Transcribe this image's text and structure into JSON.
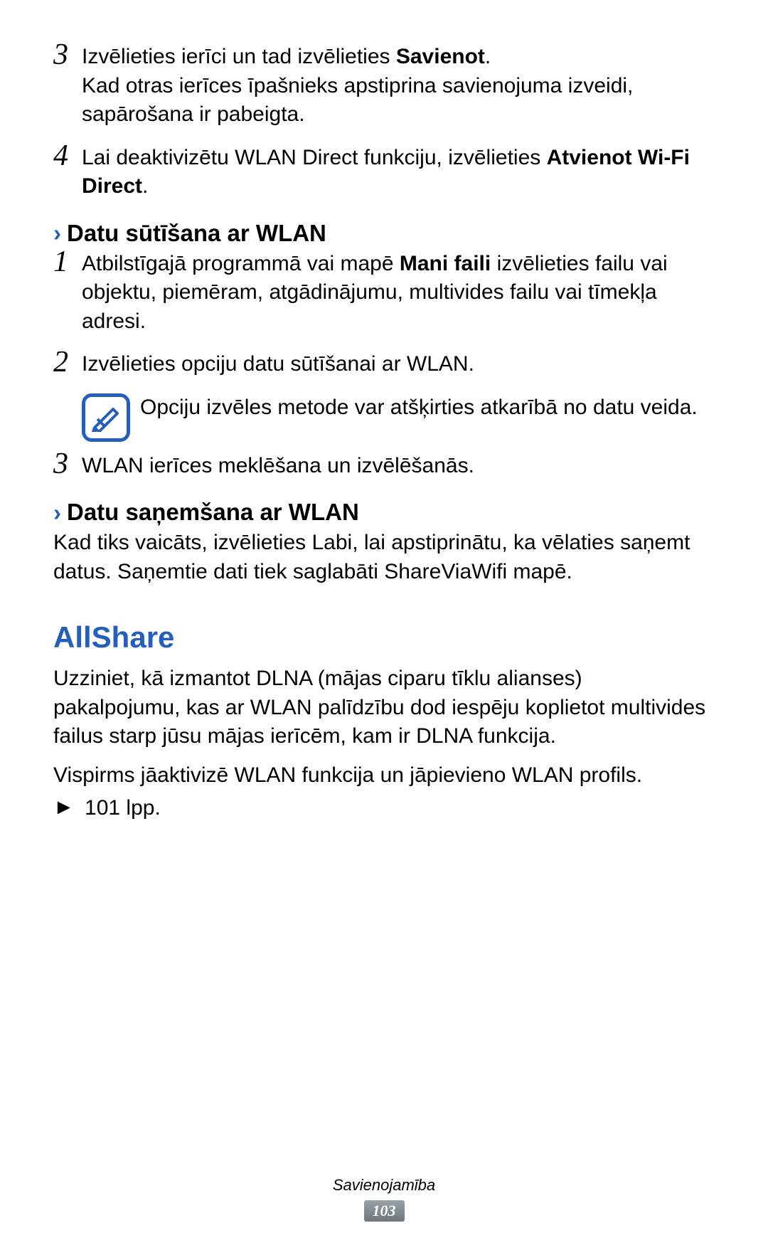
{
  "steps_a": [
    {
      "num": "3",
      "html_parts": [
        {
          "t": "Izvēlieties ierīci un tad izvēlieties ",
          "b": false
        },
        {
          "t": "Savienot",
          "b": true
        },
        {
          "t": ".",
          "b": false
        }
      ],
      "extra": "Kad otras ierīces īpašnieks apstiprina savienojuma izveidi, sapārošana ir pabeigta."
    },
    {
      "num": "4",
      "html_parts": [
        {
          "t": "Lai deaktivizētu WLAN Direct funkciju, izvēlieties ",
          "b": false
        },
        {
          "t": "Atvienot Wi-Fi Direct",
          "b": true
        },
        {
          "t": ".",
          "b": false
        }
      ]
    }
  ],
  "section1": {
    "chevron": "›",
    "title": "Datu sūtīšana ar WLAN",
    "steps": [
      {
        "num": "1",
        "html_parts": [
          {
            "t": "Atbilstīgajā programmā vai mapē ",
            "b": false
          },
          {
            "t": "Mani faili",
            "b": true
          },
          {
            "t": " izvēlieties failu vai objektu, piemēram, atgādinājumu, multivides failu vai tīmekļa adresi.",
            "b": false
          }
        ]
      },
      {
        "num": "2",
        "html_parts": [
          {
            "t": "Izvēlieties opciju datu sūtīšanai ar WLAN.",
            "b": false
          }
        ]
      }
    ],
    "note": "Opciju izvēles metode var atšķirties atkarībā no datu veida.",
    "steps_after": [
      {
        "num": "3",
        "html_parts": [
          {
            "t": "WLAN ierīces meklēšana un izvēlēšanās.",
            "b": false
          }
        ]
      }
    ]
  },
  "section2": {
    "chevron": "›",
    "title": "Datu saņemšana ar WLAN",
    "para_parts": [
      {
        "t": "Kad tiks vaicāts, izvēlieties ",
        "b": false
      },
      {
        "t": "Labi",
        "b": true
      },
      {
        "t": ", lai apstiprinātu, ka vēlaties saņemt datus. Saņemtie dati tiek saglabāti ShareViaWifi mapē.",
        "b": false
      }
    ]
  },
  "allshare": {
    "title": "AllShare",
    "para1": "Uzziniet, kā izmantot DLNA (mājas ciparu tīklu alianses) pakalpojumu, kas ar WLAN palīdzību dod iespēju koplietot multivides failus starp jūsu mājas ierīcēm, kam ir DLNA funkcija.",
    "para2": "Vispirms jāaktivizē WLAN funkcija un jāpievieno WLAN profils.",
    "cross_ref_arrow": "►",
    "cross_ref": "101 lpp."
  },
  "footer": {
    "category": "Savienojamība",
    "page": "103"
  }
}
